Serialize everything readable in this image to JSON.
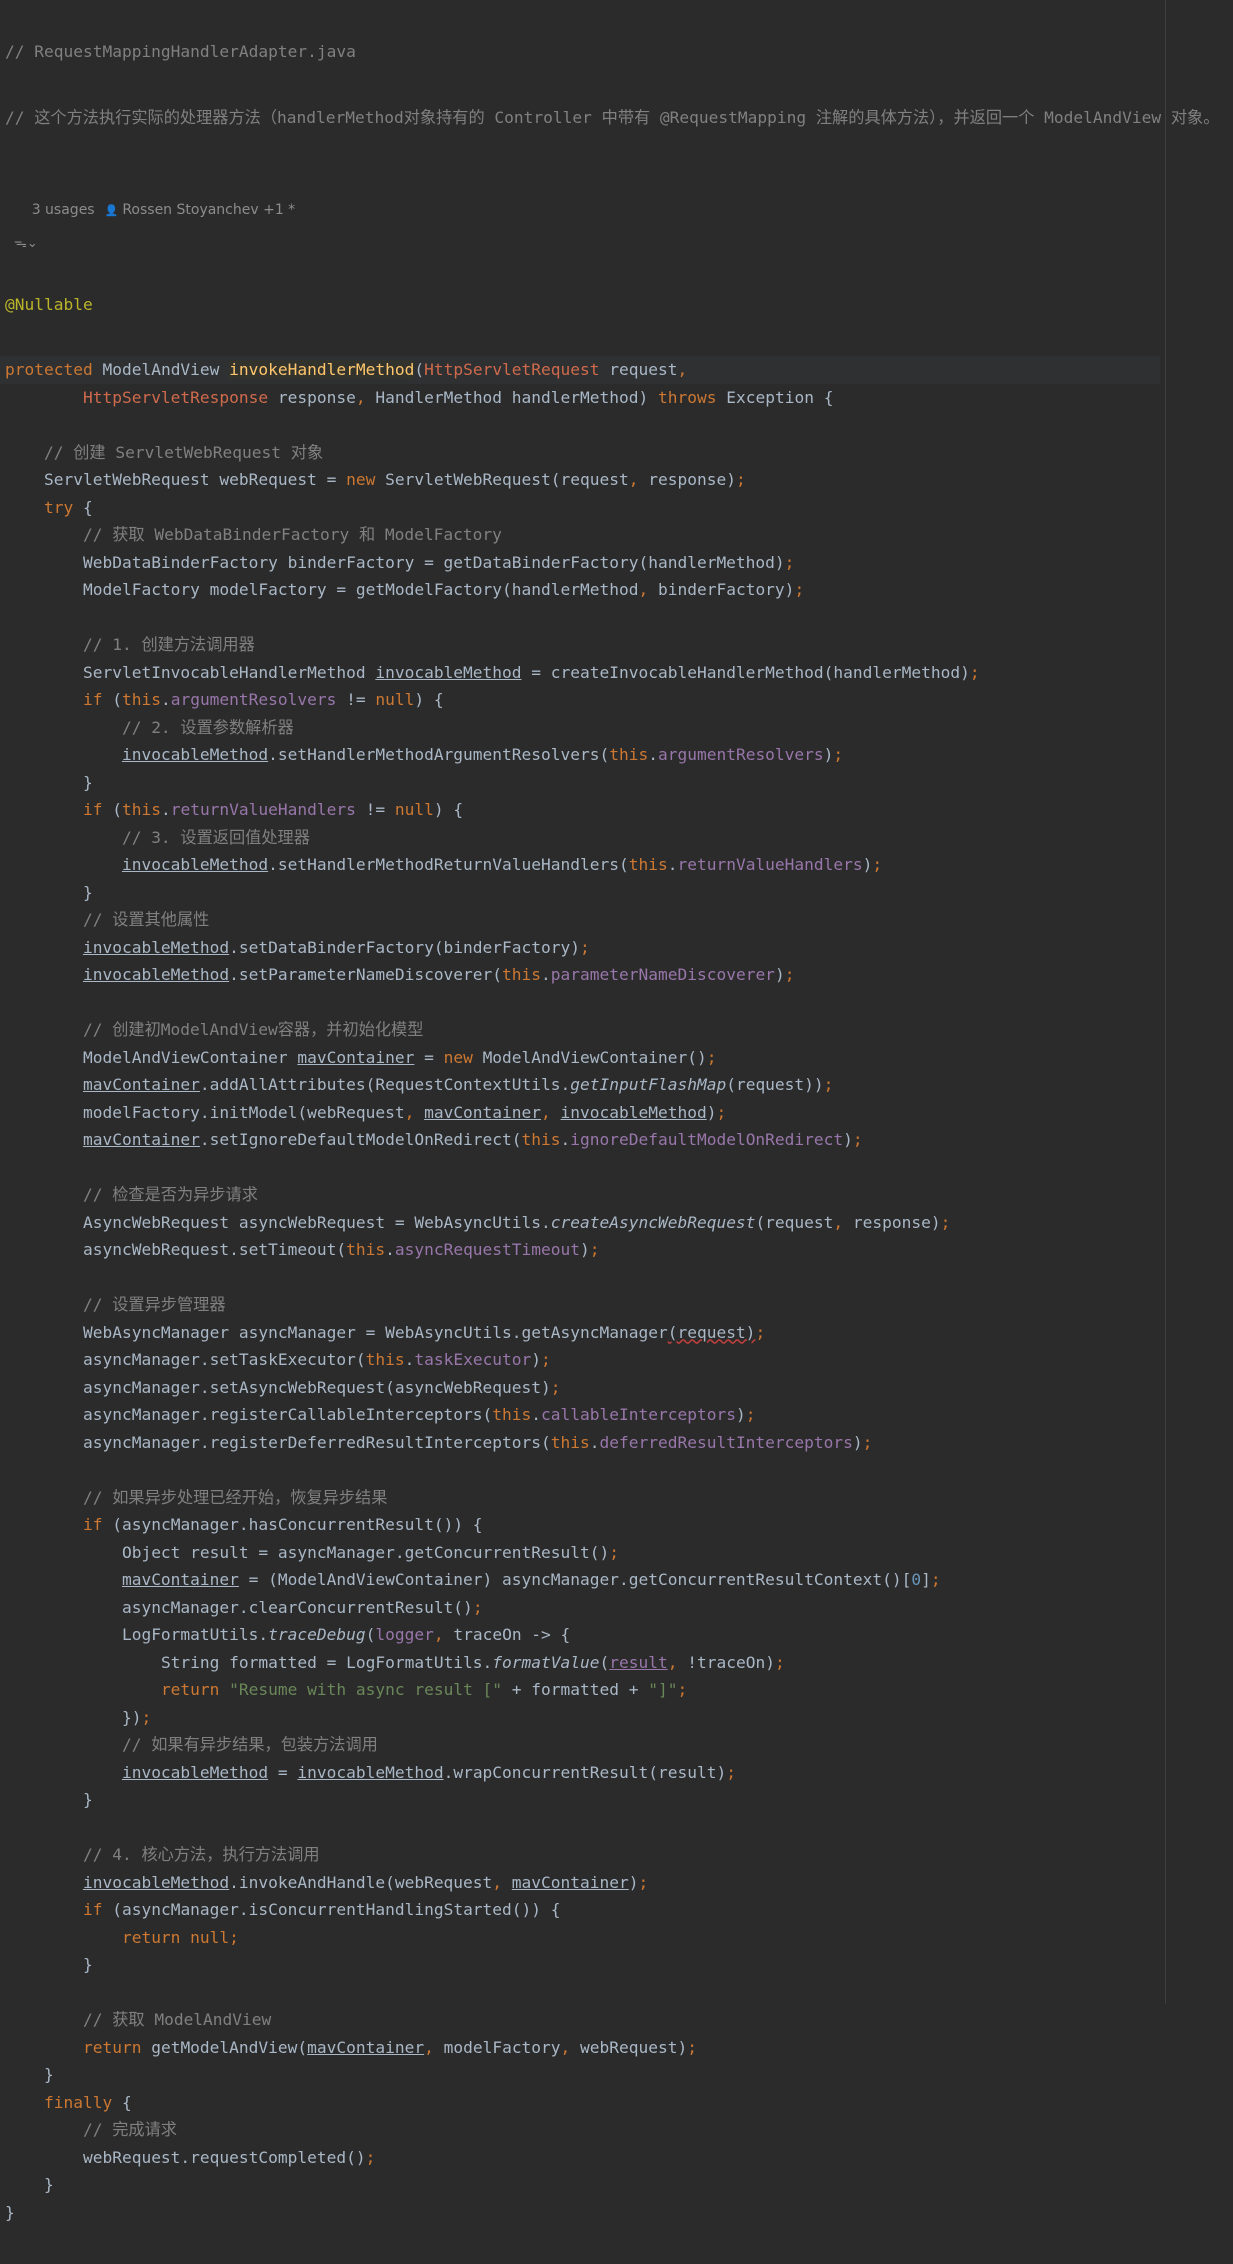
{
  "editor": {
    "file_comment": "// RequestMappingHandlerAdapter.java",
    "doc_comment": "// 这个方法执行实际的处理器方法（handlerMethod对象持有的 Controller 中带有 @RequestMapping 注解的具体方法），并返回一个 ModelAndView 对象。",
    "usages": "3 usages",
    "author": "Rossen Stoyanchev +1 *",
    "hint_icon_label": "ᯓ⌄",
    "annotation": "@Nullable",
    "method_name": "invokeHandlerMethod"
  },
  "code_lines": [
    {
      "i": 4,
      "indent": "",
      "t": [
        [
          "kw",
          "protected "
        ],
        [
          "",
          "ModelAndView "
        ],
        [
          "fn",
          "invokeHandlerMethod"
        ],
        [
          "",
          "("
        ],
        [
          "err",
          "HttpServletRequest"
        ],
        [
          "",
          " request"
        ],
        [
          "kw",
          ","
        ]
      ]
    },
    {
      "i": 5,
      "indent": "        ",
      "t": [
        [
          "err",
          "HttpServletResponse"
        ],
        [
          "",
          " response"
        ],
        [
          "kw",
          ", "
        ],
        [
          "",
          "HandlerMethod handlerMethod) "
        ],
        [
          "kw",
          "throws "
        ],
        [
          "",
          "Exception {"
        ]
      ]
    },
    {
      "i": 6,
      "indent": "",
      "t": []
    },
    {
      "i": 7,
      "indent": "    ",
      "t": [
        [
          "cm",
          "// 创建 ServletWebRequest 对象"
        ]
      ]
    },
    {
      "i": 8,
      "indent": "    ",
      "t": [
        [
          "",
          "ServletWebRequest webRequest = "
        ],
        [
          "kw",
          "new "
        ],
        [
          "",
          "ServletWebRequest(request"
        ],
        [
          "kw",
          ", "
        ],
        [
          "",
          "response)"
        ],
        [
          "kw",
          ";"
        ]
      ]
    },
    {
      "i": 9,
      "indent": "    ",
      "t": [
        [
          "kw",
          "try "
        ],
        [
          "",
          "{"
        ]
      ]
    },
    {
      "i": 10,
      "indent": "        ",
      "t": [
        [
          "cm",
          "// 获取 WebDataBinderFactory 和 ModelFactory"
        ]
      ]
    },
    {
      "i": 11,
      "indent": "        ",
      "t": [
        [
          "",
          "WebDataBinderFactory binderFactory = getDataBinderFactory(handlerMethod)"
        ],
        [
          "kw",
          ";"
        ]
      ]
    },
    {
      "i": 12,
      "indent": "        ",
      "t": [
        [
          "",
          "ModelFactory modelFactory = getModelFactory(handlerMethod"
        ],
        [
          "kw",
          ", "
        ],
        [
          "",
          "binderFactory)"
        ],
        [
          "kw",
          ";"
        ]
      ]
    },
    {
      "i": 13,
      "indent": "",
      "t": []
    },
    {
      "i": 14,
      "indent": "        ",
      "t": [
        [
          "cm",
          "// 1. 创建方法调用器"
        ]
      ]
    },
    {
      "i": 15,
      "indent": "        ",
      "t": [
        [
          "",
          "ServletInvocableHandlerMethod "
        ],
        [
          "ul",
          "invocableMethod"
        ],
        [
          "",
          " = createInvocableHandlerMethod(handlerMethod)"
        ],
        [
          "kw",
          ";"
        ]
      ]
    },
    {
      "i": 16,
      "indent": "        ",
      "t": [
        [
          "kw",
          "if "
        ],
        [
          "",
          "("
        ],
        [
          "kw",
          "this"
        ],
        [
          "",
          "."
        ],
        [
          "fld",
          "argumentResolvers"
        ],
        [
          "",
          " != "
        ],
        [
          "kw",
          "null"
        ],
        [
          "",
          ") {"
        ]
      ]
    },
    {
      "i": 17,
      "indent": "            ",
      "t": [
        [
          "cm",
          "// 2. 设置参数解析器"
        ]
      ]
    },
    {
      "i": 18,
      "indent": "            ",
      "t": [
        [
          "ul",
          "invocableMethod"
        ],
        [
          "",
          ".setHandlerMethodArgumentResolvers("
        ],
        [
          "kw",
          "this"
        ],
        [
          "",
          "."
        ],
        [
          "fld",
          "argumentResolvers"
        ],
        [
          "",
          ")"
        ],
        [
          "kw",
          ";"
        ]
      ]
    },
    {
      "i": 19,
      "indent": "        ",
      "t": [
        [
          "",
          "}"
        ]
      ]
    },
    {
      "i": 20,
      "indent": "        ",
      "t": [
        [
          "kw",
          "if "
        ],
        [
          "",
          "("
        ],
        [
          "kw",
          "this"
        ],
        [
          "",
          "."
        ],
        [
          "fld",
          "returnValueHandlers"
        ],
        [
          "",
          " != "
        ],
        [
          "kw",
          "null"
        ],
        [
          "",
          ") {"
        ]
      ]
    },
    {
      "i": 21,
      "indent": "            ",
      "t": [
        [
          "cm",
          "// 3. 设置返回值处理器"
        ]
      ]
    },
    {
      "i": 22,
      "indent": "            ",
      "t": [
        [
          "ul",
          "invocableMethod"
        ],
        [
          "",
          ".setHandlerMethodReturnValueHandlers("
        ],
        [
          "kw",
          "this"
        ],
        [
          "",
          "."
        ],
        [
          "fld",
          "returnValueHandlers"
        ],
        [
          "",
          ")"
        ],
        [
          "kw",
          ";"
        ]
      ]
    },
    {
      "i": 23,
      "indent": "        ",
      "t": [
        [
          "",
          "}"
        ]
      ]
    },
    {
      "i": 24,
      "indent": "        ",
      "t": [
        [
          "cm",
          "// 设置其他属性"
        ]
      ]
    },
    {
      "i": 25,
      "indent": "        ",
      "t": [
        [
          "ul",
          "invocableMethod"
        ],
        [
          "",
          ".setDataBinderFactory(binderFactory)"
        ],
        [
          "kw",
          ";"
        ]
      ]
    },
    {
      "i": 26,
      "indent": "        ",
      "t": [
        [
          "ul",
          "invocableMethod"
        ],
        [
          "",
          ".setParameterNameDiscoverer("
        ],
        [
          "kw",
          "this"
        ],
        [
          "",
          "."
        ],
        [
          "fld",
          "parameterNameDiscoverer"
        ],
        [
          "",
          ")"
        ],
        [
          "kw",
          ";"
        ]
      ]
    },
    {
      "i": 27,
      "indent": "",
      "t": []
    },
    {
      "i": 28,
      "indent": "        ",
      "t": [
        [
          "cm",
          "// 创建初ModelAndView容器，并初始化模型"
        ]
      ]
    },
    {
      "i": 29,
      "indent": "        ",
      "t": [
        [
          "",
          "ModelAndViewContainer "
        ],
        [
          "ul",
          "mavContainer"
        ],
        [
          "",
          " = "
        ],
        [
          "kw",
          "new "
        ],
        [
          "",
          "ModelAndViewContainer()"
        ],
        [
          "kw",
          ";"
        ]
      ]
    },
    {
      "i": 30,
      "indent": "        ",
      "t": [
        [
          "ul",
          "mavContainer"
        ],
        [
          "",
          ".addAllAttributes(RequestContextUtils."
        ],
        [
          "it",
          "getInputFlashMap"
        ],
        [
          "",
          "(request))"
        ],
        [
          "kw",
          ";"
        ]
      ]
    },
    {
      "i": 31,
      "indent": "        ",
      "t": [
        [
          "",
          "modelFactory.initModel(webRequest"
        ],
        [
          "kw",
          ", "
        ],
        [
          "ul",
          "mavContainer"
        ],
        [
          "kw",
          ", "
        ],
        [
          "ul",
          "invocableMethod"
        ],
        [
          "",
          ")"
        ],
        [
          "kw",
          ";"
        ]
      ]
    },
    {
      "i": 32,
      "indent": "        ",
      "t": [
        [
          "ul",
          "mavContainer"
        ],
        [
          "",
          ".setIgnoreDefaultModelOnRedirect("
        ],
        [
          "kw",
          "this"
        ],
        [
          "",
          "."
        ],
        [
          "fld",
          "ignoreDefaultModelOnRedirect"
        ],
        [
          "",
          ")"
        ],
        [
          "kw",
          ";"
        ]
      ]
    },
    {
      "i": 33,
      "indent": "",
      "t": []
    },
    {
      "i": 34,
      "indent": "        ",
      "t": [
        [
          "cm",
          "// 检查是否为异步请求"
        ]
      ]
    },
    {
      "i": 35,
      "indent": "        ",
      "t": [
        [
          "",
          "AsyncWebRequest asyncWebRequest = WebAsyncUtils."
        ],
        [
          "it",
          "createAsyncWebRequest"
        ],
        [
          "",
          "(request"
        ],
        [
          "kw",
          ", "
        ],
        [
          "",
          "response)"
        ],
        [
          "kw",
          ";"
        ]
      ]
    },
    {
      "i": 36,
      "indent": "        ",
      "t": [
        [
          "",
          "asyncWebRequest.setTimeout("
        ],
        [
          "kw",
          "this"
        ],
        [
          "",
          "."
        ],
        [
          "fld",
          "asyncRequestTimeout"
        ],
        [
          "",
          ")"
        ],
        [
          "kw",
          ";"
        ]
      ]
    },
    {
      "i": 37,
      "indent": "",
      "t": []
    },
    {
      "i": 38,
      "indent": "        ",
      "t": [
        [
          "cm",
          "// 设置异步管理器"
        ]
      ]
    },
    {
      "i": 39,
      "indent": "        ",
      "t": [
        [
          "",
          "WebAsyncManager asyncManager = WebAsyncUtils.getAsyncManager"
        ],
        [
          "wavy",
          "(request)"
        ],
        [
          "kw",
          ";"
        ]
      ]
    },
    {
      "i": 40,
      "indent": "        ",
      "t": [
        [
          "",
          "asyncManager.setTaskExecutor("
        ],
        [
          "kw",
          "this"
        ],
        [
          "",
          "."
        ],
        [
          "fld",
          "taskExecutor"
        ],
        [
          "",
          ")"
        ],
        [
          "kw",
          ";"
        ]
      ]
    },
    {
      "i": 41,
      "indent": "        ",
      "t": [
        [
          "",
          "asyncManager.setAsyncWebRequest(asyncWebRequest)"
        ],
        [
          "kw",
          ";"
        ]
      ]
    },
    {
      "i": 42,
      "indent": "        ",
      "t": [
        [
          "",
          "asyncManager.registerCallableInterceptors("
        ],
        [
          "kw",
          "this"
        ],
        [
          "",
          "."
        ],
        [
          "fld",
          "callableInterceptors"
        ],
        [
          "",
          ")"
        ],
        [
          "kw",
          ";"
        ]
      ]
    },
    {
      "i": 43,
      "indent": "        ",
      "t": [
        [
          "",
          "asyncManager.registerDeferredResultInterceptors("
        ],
        [
          "kw",
          "this"
        ],
        [
          "",
          "."
        ],
        [
          "fld",
          "deferredResultInterceptors"
        ],
        [
          "",
          ")"
        ],
        [
          "kw",
          ";"
        ]
      ]
    },
    {
      "i": 44,
      "indent": "",
      "t": []
    },
    {
      "i": 45,
      "indent": "        ",
      "t": [
        [
          "cm",
          "// 如果异步处理已经开始，恢复异步结果"
        ]
      ]
    },
    {
      "i": 46,
      "indent": "        ",
      "t": [
        [
          "kw",
          "if "
        ],
        [
          "",
          "(asyncManager.hasConcurrentResult()) {"
        ]
      ]
    },
    {
      "i": 47,
      "indent": "            ",
      "t": [
        [
          "",
          "Object result = asyncManager.getConcurrentResult()"
        ],
        [
          "kw",
          ";"
        ]
      ]
    },
    {
      "i": 48,
      "indent": "            ",
      "t": [
        [
          "ul",
          "mavContainer"
        ],
        [
          "",
          " = (ModelAndViewContainer) asyncManager.getConcurrentResultContext()["
        ],
        [
          "num",
          "0"
        ],
        [
          "",
          "]"
        ],
        [
          "kw",
          ";"
        ]
      ]
    },
    {
      "i": 49,
      "indent": "            ",
      "t": [
        [
          "",
          "asyncManager.clearConcurrentResult()"
        ],
        [
          "kw",
          ";"
        ]
      ]
    },
    {
      "i": 50,
      "indent": "            ",
      "t": [
        [
          "",
          "LogFormatUtils."
        ],
        [
          "it",
          "traceDebug"
        ],
        [
          "",
          "("
        ],
        [
          "fld",
          "logger"
        ],
        [
          "kw",
          ", "
        ],
        [
          "",
          "traceOn -> {"
        ]
      ]
    },
    {
      "i": 51,
      "indent": "                ",
      "t": [
        [
          "",
          "String formatted = LogFormatUtils."
        ],
        [
          "it",
          "formatValue"
        ],
        [
          "",
          "("
        ],
        [
          "ul fld",
          "result"
        ],
        [
          "kw",
          ", "
        ],
        [
          "",
          "!traceOn)"
        ],
        [
          "kw",
          ";"
        ]
      ]
    },
    {
      "i": 52,
      "indent": "                ",
      "t": [
        [
          "kw",
          "return "
        ],
        [
          "str",
          "\"Resume with async result [\""
        ],
        [
          "",
          " + formatted + "
        ],
        [
          "str",
          "\"]\""
        ],
        [
          "kw",
          ";"
        ]
      ]
    },
    {
      "i": 53,
      "indent": "            ",
      "t": [
        [
          "",
          "})"
        ],
        [
          "kw",
          ";"
        ]
      ]
    },
    {
      "i": 54,
      "indent": "            ",
      "t": [
        [
          "cm",
          "// 如果有异步结果，包装方法调用"
        ]
      ]
    },
    {
      "i": 55,
      "indent": "            ",
      "t": [
        [
          "ul",
          "invocableMethod"
        ],
        [
          "",
          " = "
        ],
        [
          "ul",
          "invocableMethod"
        ],
        [
          "",
          ".wrapConcurrentResult(result)"
        ],
        [
          "kw",
          ";"
        ]
      ]
    },
    {
      "i": 56,
      "indent": "        ",
      "t": [
        [
          "",
          "}"
        ]
      ]
    },
    {
      "i": 57,
      "indent": "",
      "t": []
    },
    {
      "i": 58,
      "indent": "        ",
      "t": [
        [
          "cm",
          "// 4. 核心方法，执行方法调用"
        ]
      ]
    },
    {
      "i": 59,
      "indent": "        ",
      "t": [
        [
          "ul",
          "invocableMethod"
        ],
        [
          "",
          ".invokeAndHandle(webRequest"
        ],
        [
          "kw",
          ", "
        ],
        [
          "ul",
          "mavContainer"
        ],
        [
          "",
          ")"
        ],
        [
          "kw",
          ";"
        ]
      ]
    },
    {
      "i": 60,
      "indent": "        ",
      "t": [
        [
          "kw",
          "if "
        ],
        [
          "",
          "(asyncManager.isConcurrentHandlingStarted()) {"
        ]
      ]
    },
    {
      "i": 61,
      "indent": "            ",
      "t": [
        [
          "kw",
          "return null;"
        ]
      ]
    },
    {
      "i": 62,
      "indent": "        ",
      "t": [
        [
          "",
          "}"
        ]
      ]
    },
    {
      "i": 63,
      "indent": "",
      "t": []
    },
    {
      "i": 64,
      "indent": "        ",
      "t": [
        [
          "cm",
          "// 获取 ModelAndView"
        ]
      ]
    },
    {
      "i": 65,
      "indent": "        ",
      "t": [
        [
          "kw",
          "return "
        ],
        [
          "",
          "getModelAndView("
        ],
        [
          "ul",
          "mavContainer"
        ],
        [
          "kw",
          ", "
        ],
        [
          "",
          "modelFactory"
        ],
        [
          "kw",
          ", "
        ],
        [
          "",
          "webRequest)"
        ],
        [
          "kw",
          ";"
        ]
      ]
    },
    {
      "i": 66,
      "indent": "    ",
      "t": [
        [
          "",
          "}"
        ]
      ]
    },
    {
      "i": 67,
      "indent": "    ",
      "t": [
        [
          "kw",
          "finally "
        ],
        [
          "",
          "{"
        ]
      ]
    },
    {
      "i": 68,
      "indent": "        ",
      "t": [
        [
          "cm",
          "// 完成请求"
        ]
      ]
    },
    {
      "i": 69,
      "indent": "        ",
      "t": [
        [
          "",
          "webRequest.requestCompleted()"
        ],
        [
          "kw",
          ";"
        ]
      ]
    },
    {
      "i": 70,
      "indent": "    ",
      "t": [
        [
          "",
          "}"
        ]
      ]
    },
    {
      "i": 71,
      "indent": "",
      "t": [
        [
          "",
          "}"
        ]
      ]
    }
  ]
}
